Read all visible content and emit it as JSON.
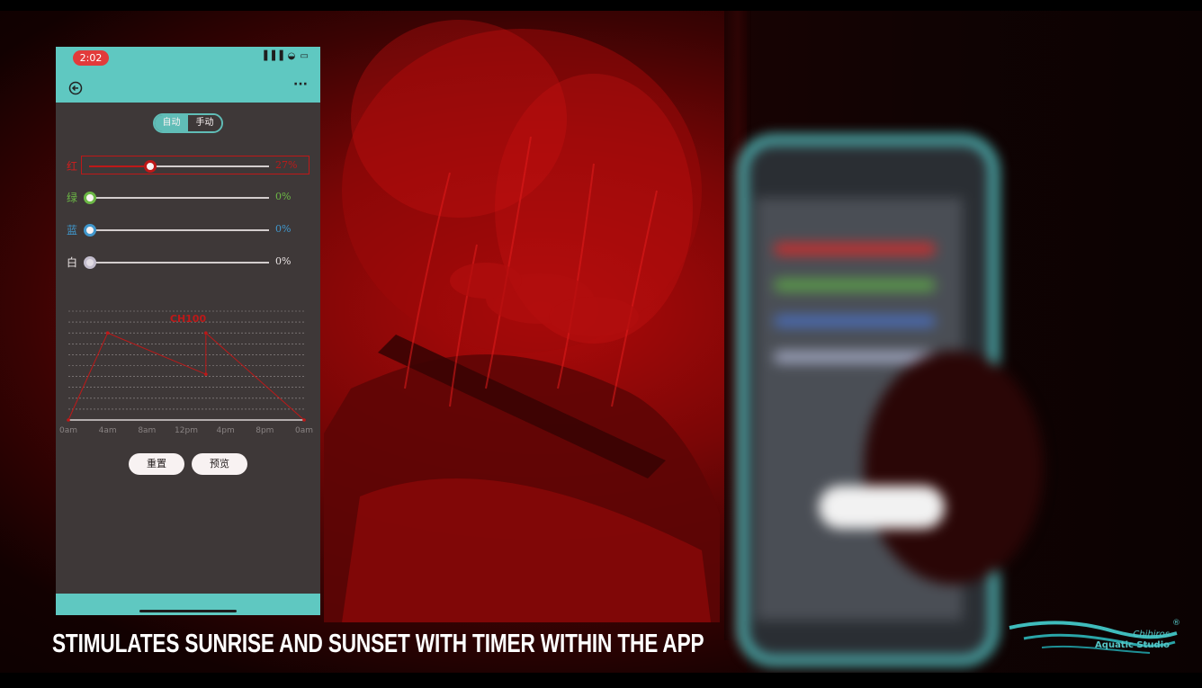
{
  "phone": {
    "time": "2:02",
    "status_icons": "▐▐▐ ◒ ▭",
    "more_label": "···",
    "mode": {
      "auto_label": "自动",
      "manual_label": "手动",
      "selected": "auto"
    },
    "channels": [
      {
        "label": "红",
        "value_text": "27%",
        "value": 27,
        "color": "#d42020"
      },
      {
        "label": "绿",
        "value_text": "0%",
        "value": 0,
        "color": "#6cc24a"
      },
      {
        "label": "蓝",
        "value_text": "0%",
        "value": 0,
        "color": "#3ea0d8"
      },
      {
        "label": "白",
        "value_text": "0%",
        "value": 0,
        "color": "#e8e8f0"
      }
    ],
    "buttons": {
      "reset_label": "重置",
      "preview_label": "预览"
    }
  },
  "chart_data": {
    "type": "line",
    "title": "CH100",
    "x_labels": [
      "0am",
      "4am",
      "8am",
      "12pm",
      "4pm",
      "8pm",
      "0am"
    ],
    "x_hours": [
      0,
      4,
      8,
      12,
      16,
      20,
      24
    ],
    "series": [
      {
        "color": "#c21a1a",
        "points": [
          [
            0,
            0
          ],
          [
            4,
            80
          ],
          [
            14,
            42
          ],
          [
            14,
            80
          ],
          [
            24,
            0
          ]
        ]
      }
    ],
    "ylim": [
      0,
      100
    ],
    "grid": true
  },
  "caption": "STIMULATES SUNRISE AND SUNSET WITH TIMER WITHIN THE APP",
  "logo": {
    "line1": "Chihiros",
    "line2": "Aquatic Studio",
    "mark": "®"
  },
  "colors": {
    "accent": "#5fc8c1",
    "red_light": "#c21a1a"
  }
}
